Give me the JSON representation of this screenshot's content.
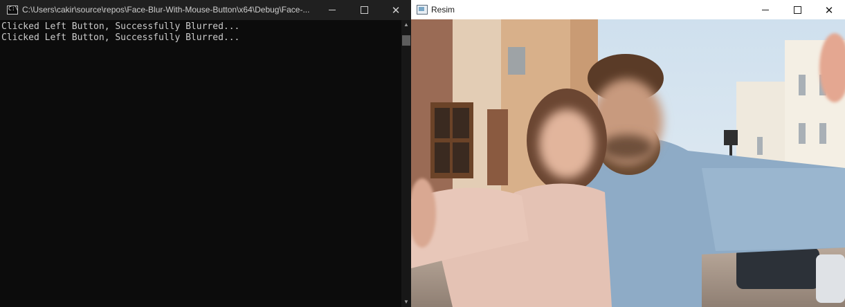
{
  "console": {
    "title": "C:\\Users\\cakir\\source\\repos\\Face-Blur-With-Mouse-Button\\x64\\Debug\\Face-...",
    "lines": [
      "Clicked Left Button, Successfully Blurred...",
      "Clicked Left Button, Successfully Blurred..."
    ],
    "icon": "console-app-icon",
    "icon_glyph": "C:\\",
    "controls": {
      "minimize": "minimize-icon",
      "maximize": "maximize-icon",
      "close": "close-icon"
    }
  },
  "image_window": {
    "title": "Resim",
    "icon": "image-window-icon",
    "close_glyph": "✕",
    "controls": {
      "minimize": "minimize-icon",
      "maximize": "maximize-icon",
      "close": "close-icon"
    }
  },
  "colors": {
    "console_bg": "#0c0c0c",
    "console_titlebar": "#202020",
    "console_text": "#cccccc",
    "image_titlebar": "#ffffff"
  }
}
